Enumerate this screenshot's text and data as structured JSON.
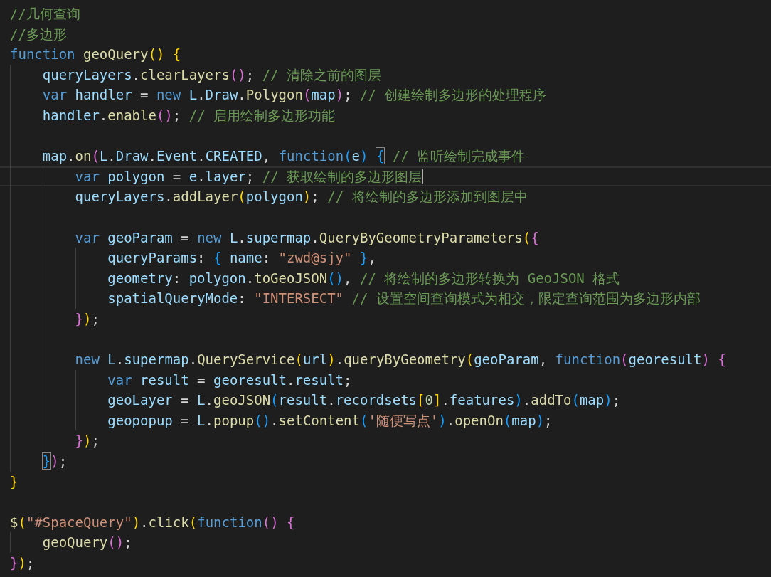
{
  "lines": [
    {
      "kind": "code",
      "current": false,
      "tokens": [
        {
          "kind": "comment",
          "text": "//几何查询"
        }
      ]
    },
    {
      "kind": "code",
      "current": false,
      "tokens": [
        {
          "kind": "comment",
          "text": "//多边形"
        }
      ]
    },
    {
      "kind": "code",
      "current": false,
      "tokens": [
        {
          "kind": "keyword",
          "text": "function "
        },
        {
          "kind": "function",
          "text": "geoQuery"
        },
        {
          "kind": "bracket1",
          "text": "() {"
        }
      ],
      "children": [
        {
          "kind": "code",
          "current": false,
          "tokens": [
            {
              "kind": "variable",
              "text": "queryLayers"
            },
            {
              "kind": "plain",
              "text": "."
            },
            {
              "kind": "function",
              "text": "clearLayers"
            },
            {
              "kind": "bracket2",
              "text": "()"
            },
            {
              "kind": "plain",
              "text": "; "
            },
            {
              "kind": "comment",
              "text": "// 清除之前的图层"
            }
          ]
        },
        {
          "kind": "code",
          "current": false,
          "tokens": [
            {
              "kind": "keyword",
              "text": "var "
            },
            {
              "kind": "variable",
              "text": "handler"
            },
            {
              "kind": "plain",
              "text": " = "
            },
            {
              "kind": "keyword",
              "text": "new "
            },
            {
              "kind": "variable",
              "text": "L"
            },
            {
              "kind": "plain",
              "text": "."
            },
            {
              "kind": "variable",
              "text": "Draw"
            },
            {
              "kind": "plain",
              "text": "."
            },
            {
              "kind": "function",
              "text": "Polygon"
            },
            {
              "kind": "bracket2",
              "text": "("
            },
            {
              "kind": "variable",
              "text": "map"
            },
            {
              "kind": "bracket2",
              "text": ")"
            },
            {
              "kind": "plain",
              "text": "; "
            },
            {
              "kind": "comment",
              "text": "// 创建绘制多边形的处理程序"
            }
          ]
        },
        {
          "kind": "code",
          "current": false,
          "tokens": [
            {
              "kind": "variable",
              "text": "handler"
            },
            {
              "kind": "plain",
              "text": "."
            },
            {
              "kind": "function",
              "text": "enable"
            },
            {
              "kind": "bracket2",
              "text": "()"
            },
            {
              "kind": "plain",
              "text": "; "
            },
            {
              "kind": "comment",
              "text": "// 启用绘制多边形功能"
            }
          ]
        },
        {
          "kind": "blank"
        },
        {
          "kind": "code",
          "current": false,
          "tokens": [
            {
              "kind": "variable",
              "text": "map"
            },
            {
              "kind": "plain",
              "text": "."
            },
            {
              "kind": "function",
              "text": "on"
            },
            {
              "kind": "bracket2",
              "text": "("
            },
            {
              "kind": "variable",
              "text": "L"
            },
            {
              "kind": "plain",
              "text": "."
            },
            {
              "kind": "variable",
              "text": "Draw"
            },
            {
              "kind": "plain",
              "text": "."
            },
            {
              "kind": "variable",
              "text": "Event"
            },
            {
              "kind": "plain",
              "text": "."
            },
            {
              "kind": "variable",
              "text": "CREATED"
            },
            {
              "kind": "plain",
              "text": ", "
            },
            {
              "kind": "keyword",
              "text": "function"
            },
            {
              "kind": "bracket3",
              "text": "("
            },
            {
              "kind": "variable",
              "text": "e"
            },
            {
              "kind": "bracket3",
              "text": ") "
            },
            {
              "kind": "bracket3",
              "text": "{",
              "matched": true
            },
            {
              "kind": "comment",
              "text": " // 监听绘制完成事件"
            }
          ],
          "children": [
            {
              "kind": "code",
              "current": true,
              "tokens": [
                {
                  "kind": "keyword",
                  "text": "var "
                },
                {
                  "kind": "variable",
                  "text": "polygon"
                },
                {
                  "kind": "plain",
                  "text": " = "
                },
                {
                  "kind": "variable",
                  "text": "e"
                },
                {
                  "kind": "plain",
                  "text": "."
                },
                {
                  "kind": "variable",
                  "text": "layer"
                },
                {
                  "kind": "plain",
                  "text": "; "
                },
                {
                  "kind": "comment",
                  "text": "// 获取绘制的多边形图层"
                }
              ]
            },
            {
              "kind": "code",
              "current": false,
              "tokens": [
                {
                  "kind": "variable",
                  "text": "queryLayers"
                },
                {
                  "kind": "plain",
                  "text": "."
                },
                {
                  "kind": "function",
                  "text": "addLayer"
                },
                {
                  "kind": "bracket1",
                  "text": "("
                },
                {
                  "kind": "variable",
                  "text": "polygon"
                },
                {
                  "kind": "bracket1",
                  "text": ")"
                },
                {
                  "kind": "plain",
                  "text": "; "
                },
                {
                  "kind": "comment",
                  "text": "// 将绘制的多边形添加到图层中"
                }
              ]
            },
            {
              "kind": "blank"
            },
            {
              "kind": "code",
              "current": false,
              "tokens": [
                {
                  "kind": "keyword",
                  "text": "var "
                },
                {
                  "kind": "variable",
                  "text": "geoParam"
                },
                {
                  "kind": "plain",
                  "text": " = "
                },
                {
                  "kind": "keyword",
                  "text": "new "
                },
                {
                  "kind": "variable",
                  "text": "L"
                },
                {
                  "kind": "plain",
                  "text": "."
                },
                {
                  "kind": "variable",
                  "text": "supermap"
                },
                {
                  "kind": "plain",
                  "text": "."
                },
                {
                  "kind": "function",
                  "text": "QueryByGeometryParameters"
                },
                {
                  "kind": "bracket1",
                  "text": "("
                },
                {
                  "kind": "bracket2",
                  "text": "{"
                }
              ],
              "children": [
                {
                  "kind": "code",
                  "current": false,
                  "tokens": [
                    {
                      "kind": "variable",
                      "text": "queryParams"
                    },
                    {
                      "kind": "plain",
                      "text": ": "
                    },
                    {
                      "kind": "bracket3",
                      "text": "{ "
                    },
                    {
                      "kind": "variable",
                      "text": "name"
                    },
                    {
                      "kind": "plain",
                      "text": ": "
                    },
                    {
                      "kind": "string",
                      "text": "\"zwd@sjy\""
                    },
                    {
                      "kind": "bracket3",
                      "text": " }"
                    },
                    {
                      "kind": "plain",
                      "text": ","
                    }
                  ]
                },
                {
                  "kind": "code",
                  "current": false,
                  "tokens": [
                    {
                      "kind": "variable",
                      "text": "geometry"
                    },
                    {
                      "kind": "plain",
                      "text": ": "
                    },
                    {
                      "kind": "variable",
                      "text": "polygon"
                    },
                    {
                      "kind": "plain",
                      "text": "."
                    },
                    {
                      "kind": "function",
                      "text": "toGeoJSON"
                    },
                    {
                      "kind": "bracket3",
                      "text": "()"
                    },
                    {
                      "kind": "plain",
                      "text": ", "
                    },
                    {
                      "kind": "comment",
                      "text": "// 将绘制的多边形转换为 GeoJSON 格式"
                    }
                  ]
                },
                {
                  "kind": "code",
                  "current": false,
                  "tokens": [
                    {
                      "kind": "variable",
                      "text": "spatialQueryMode"
                    },
                    {
                      "kind": "plain",
                      "text": ": "
                    },
                    {
                      "kind": "string",
                      "text": "\"INTERSECT\""
                    },
                    {
                      "kind": "comment",
                      "text": " // 设置空间查询模式为相交，限定查询范围为多边形内部"
                    }
                  ]
                }
              ]
            },
            {
              "kind": "code",
              "current": false,
              "tokens": [
                {
                  "kind": "bracket2",
                  "text": "}"
                },
                {
                  "kind": "bracket1",
                  "text": ")"
                },
                {
                  "kind": "plain",
                  "text": ";"
                }
              ]
            },
            {
              "kind": "blank"
            },
            {
              "kind": "code",
              "current": false,
              "tokens": [
                {
                  "kind": "keyword",
                  "text": "new "
                },
                {
                  "kind": "variable",
                  "text": "L"
                },
                {
                  "kind": "plain",
                  "text": "."
                },
                {
                  "kind": "variable",
                  "text": "supermap"
                },
                {
                  "kind": "plain",
                  "text": "."
                },
                {
                  "kind": "function",
                  "text": "QueryService"
                },
                {
                  "kind": "bracket1",
                  "text": "("
                },
                {
                  "kind": "variable",
                  "text": "url"
                },
                {
                  "kind": "bracket1",
                  "text": ")"
                },
                {
                  "kind": "plain",
                  "text": "."
                },
                {
                  "kind": "function",
                  "text": "queryByGeometry"
                },
                {
                  "kind": "bracket1",
                  "text": "("
                },
                {
                  "kind": "variable",
                  "text": "geoParam"
                },
                {
                  "kind": "plain",
                  "text": ", "
                },
                {
                  "kind": "keyword",
                  "text": "function"
                },
                {
                  "kind": "bracket2",
                  "text": "("
                },
                {
                  "kind": "variable",
                  "text": "georesult"
                },
                {
                  "kind": "bracket2",
                  "text": ") {"
                }
              ],
              "children": [
                {
                  "kind": "code",
                  "current": false,
                  "tokens": [
                    {
                      "kind": "keyword",
                      "text": "var "
                    },
                    {
                      "kind": "variable",
                      "text": "result"
                    },
                    {
                      "kind": "plain",
                      "text": " = "
                    },
                    {
                      "kind": "variable",
                      "text": "georesult"
                    },
                    {
                      "kind": "plain",
                      "text": "."
                    },
                    {
                      "kind": "variable",
                      "text": "result"
                    },
                    {
                      "kind": "plain",
                      "text": ";"
                    }
                  ]
                },
                {
                  "kind": "code",
                  "current": false,
                  "tokens": [
                    {
                      "kind": "variable",
                      "text": "geoLayer"
                    },
                    {
                      "kind": "plain",
                      "text": " = "
                    },
                    {
                      "kind": "variable",
                      "text": "L"
                    },
                    {
                      "kind": "plain",
                      "text": "."
                    },
                    {
                      "kind": "function",
                      "text": "geoJSON"
                    },
                    {
                      "kind": "bracket3",
                      "text": "("
                    },
                    {
                      "kind": "variable",
                      "text": "result"
                    },
                    {
                      "kind": "plain",
                      "text": "."
                    },
                    {
                      "kind": "variable",
                      "text": "recordsets"
                    },
                    {
                      "kind": "bracket1",
                      "text": "["
                    },
                    {
                      "kind": "number",
                      "text": "0"
                    },
                    {
                      "kind": "bracket1",
                      "text": "]"
                    },
                    {
                      "kind": "plain",
                      "text": "."
                    },
                    {
                      "kind": "variable",
                      "text": "features"
                    },
                    {
                      "kind": "bracket3",
                      "text": ")"
                    },
                    {
                      "kind": "plain",
                      "text": "."
                    },
                    {
                      "kind": "function",
                      "text": "addTo"
                    },
                    {
                      "kind": "bracket3",
                      "text": "("
                    },
                    {
                      "kind": "variable",
                      "text": "map"
                    },
                    {
                      "kind": "bracket3",
                      "text": ")"
                    },
                    {
                      "kind": "plain",
                      "text": ";"
                    }
                  ]
                },
                {
                  "kind": "code",
                  "current": false,
                  "tokens": [
                    {
                      "kind": "variable",
                      "text": "geopopup"
                    },
                    {
                      "kind": "plain",
                      "text": " = "
                    },
                    {
                      "kind": "variable",
                      "text": "L"
                    },
                    {
                      "kind": "plain",
                      "text": "."
                    },
                    {
                      "kind": "function",
                      "text": "popup"
                    },
                    {
                      "kind": "bracket3",
                      "text": "()"
                    },
                    {
                      "kind": "plain",
                      "text": "."
                    },
                    {
                      "kind": "function",
                      "text": "setContent"
                    },
                    {
                      "kind": "bracket3",
                      "text": "("
                    },
                    {
                      "kind": "string",
                      "text": "'随便写点'"
                    },
                    {
                      "kind": "bracket3",
                      "text": ")"
                    },
                    {
                      "kind": "plain",
                      "text": "."
                    },
                    {
                      "kind": "function",
                      "text": "openOn"
                    },
                    {
                      "kind": "bracket3",
                      "text": "("
                    },
                    {
                      "kind": "variable",
                      "text": "map"
                    },
                    {
                      "kind": "bracket3",
                      "text": ")"
                    },
                    {
                      "kind": "plain",
                      "text": ";"
                    }
                  ]
                }
              ]
            },
            {
              "kind": "code",
              "current": false,
              "tokens": [
                {
                  "kind": "bracket2",
                  "text": "}"
                },
                {
                  "kind": "bracket1",
                  "text": ")"
                },
                {
                  "kind": "plain",
                  "text": ";"
                }
              ]
            }
          ]
        },
        {
          "kind": "code",
          "current": false,
          "tokens": [
            {
              "kind": "bracket3",
              "text": "}",
              "matched": true
            },
            {
              "kind": "bracket2",
              "text": ")"
            },
            {
              "kind": "plain",
              "text": ";"
            }
          ]
        }
      ]
    },
    {
      "kind": "code",
      "current": false,
      "tokens": [
        {
          "kind": "bracket1",
          "text": "}"
        }
      ]
    },
    {
      "kind": "blank"
    },
    {
      "kind": "code",
      "current": false,
      "tokens": [
        {
          "kind": "function",
          "text": "$"
        },
        {
          "kind": "bracket1",
          "text": "("
        },
        {
          "kind": "string",
          "text": "\"#SpaceQuery\""
        },
        {
          "kind": "bracket1",
          "text": ")"
        },
        {
          "kind": "plain",
          "text": "."
        },
        {
          "kind": "function",
          "text": "click"
        },
        {
          "kind": "bracket1",
          "text": "("
        },
        {
          "kind": "keyword",
          "text": "function"
        },
        {
          "kind": "bracket2",
          "text": "() {"
        }
      ],
      "children": [
        {
          "kind": "code",
          "current": false,
          "tokens": [
            {
              "kind": "function",
              "text": "geoQuery"
            },
            {
              "kind": "bracket2",
              "text": "()"
            },
            {
              "kind": "plain",
              "text": ";"
            }
          ]
        }
      ]
    },
    {
      "kind": "code",
      "current": false,
      "tokens": [
        {
          "kind": "bracket2",
          "text": "}"
        },
        {
          "kind": "bracket1",
          "text": ")"
        },
        {
          "kind": "plain",
          "text": ";"
        }
      ]
    }
  ]
}
